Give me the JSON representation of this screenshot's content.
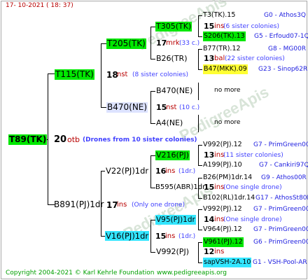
{
  "header": {
    "timestamp": "17- 10-2021 ( 18: 37)"
  },
  "footer": {
    "copyright": "Copyright 2004-2021 © Karl Kehrle Foundation",
    "site": "www.pedigreeapis.org"
  },
  "watermark": "PedigreeApis",
  "colors": {
    "green": "#00e800",
    "yellow": "#ffff33",
    "cyan": "#33e6ff",
    "lavender": "#dde3ff",
    "red": "#b80000",
    "blue": "#2020e0"
  },
  "root": {
    "id": "T89(TK)",
    "year": "20",
    "ins": "otb",
    "note": "(Drones from 10 sister colonies)"
  },
  "gen1": {
    "mother": {
      "id": "T115(TK)",
      "year": "18",
      "ins": "nst",
      "note": "(8 sister colonies)"
    },
    "father": {
      "id": "B891(PJ)1dr",
      "year": "17",
      "ins": "ins",
      "note": "(Only one drone)"
    }
  },
  "gen2": {
    "mm": {
      "id": "T205(TK)",
      "year": "17",
      "ins": "mrk",
      "note": "(33 c.)"
    },
    "mf": {
      "id": "B470(NE)",
      "year": "15",
      "ins": "nst",
      "note": "(10 c.)"
    },
    "fm": {
      "id": "V22(PJ)1dr",
      "year": "16",
      "ins": "ins",
      "note": "(1dr.)"
    },
    "ff": {
      "id": "V16(PJ)1dr",
      "year": "15",
      "ins": "ins",
      "note": "(1dr.)"
    }
  },
  "gen3": {
    "mmm": {
      "id": "T305(TK)",
      "year": "15",
      "ins": "ins",
      "note": "(6 sister colonies)"
    },
    "mmf": {
      "id": "B26(TR)",
      "year": "13",
      "ins": "bal",
      "note": "(22 sister colonies)"
    },
    "mfm": {
      "id": "B470(NE)"
    },
    "mff": {
      "id": "A4(NE)"
    },
    "fmm": {
      "id": "V216(PJ)",
      "year": "13",
      "ins": "ins",
      "note": "(11 sister colonies)"
    },
    "fmf": {
      "id": "B595(ABR)1dr",
      "year": "15",
      "ins": "ins",
      "note": "(One single drone)"
    },
    "ffm": {
      "id": "V95(PJ)1dr",
      "year": "14",
      "ins": "ins",
      "note": "(One single drone)"
    },
    "fff": {
      "id": "V992(PJ)",
      "year": "12",
      "ins": "ins"
    }
  },
  "gen4": [
    {
      "id": "T3(TK).15",
      "code": "G0 - Athos3Q"
    },
    {
      "id": "S206(TK).13",
      "code": "G5 - Erfoud07-1Q"
    },
    {
      "id": "B77(TR).12",
      "code": "G8 - MG00R"
    },
    {
      "id": "B47(MKK).09",
      "code": "G23 - Sinop62R"
    },
    {
      "id": "no more",
      "code": ""
    },
    {
      "id": "no more",
      "code": ""
    },
    {
      "id": "V992(PJ).12",
      "code": "G7 - PrimGreen00"
    },
    {
      "id": "A199(PJ).10",
      "code": "G7 - Cankiri97Q"
    },
    {
      "id": "B26(PM)1dr.14",
      "code": "G9 - Athos00R"
    },
    {
      "id": "B102(RL)1dr.14",
      "code": "G17 - AthosSt80R"
    },
    {
      "id": "V992(PJ).12",
      "code": "G7 - PrimGreen00"
    },
    {
      "id": "V964(PJ).12",
      "code": "G7 - PrimGreen00"
    },
    {
      "id": "V961(PJ).12",
      "code": "G6 - PrimGreen00"
    },
    {
      "id": "sapVSH-2A.10",
      "code": "G1 - VSH-Pool-AR"
    }
  ]
}
